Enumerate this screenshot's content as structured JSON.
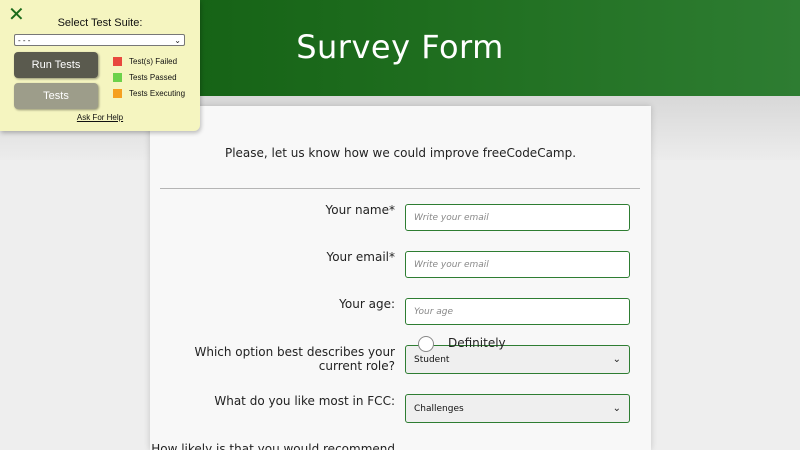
{
  "header": {
    "title": "Survey Form"
  },
  "form": {
    "intro": "Please, let us know how we could improve freeCodeCamp.",
    "name": {
      "label": "Your name*",
      "placeholder": "Write your email",
      "value": ""
    },
    "email": {
      "label": "Your email*",
      "placeholder": "Write your email",
      "value": ""
    },
    "age": {
      "label": "Your age:",
      "placeholder": "Your age",
      "value": ""
    },
    "role": {
      "label": "Which option best describes your current role?",
      "selected": "Student"
    },
    "like": {
      "label": "What do you like most in FCC:",
      "selected": "Challenges"
    },
    "recommend": {
      "label": "How likely is that you would recommend",
      "first_option": "Definitely"
    }
  },
  "test_panel": {
    "close_glyph": "✕",
    "title": "Select Test Suite:",
    "suite_selected": "- - -",
    "run_button": "Run Tests",
    "tests_button": "Tests",
    "legend": [
      {
        "label": "Test(s) Failed",
        "color": "#e8483d"
      },
      {
        "label": "Tests Passed",
        "color": "#6cd24a"
      },
      {
        "label": "Tests Executing",
        "color": "#f5a020"
      }
    ],
    "help_link": "Ask For Help"
  },
  "colors": {
    "brand_green": "#1f6e1f",
    "field_border": "#2e7d32",
    "panel_bg": "#f5f5c0"
  },
  "icons": {
    "close": "close-icon",
    "dropdown": "chevron-down-icon"
  }
}
